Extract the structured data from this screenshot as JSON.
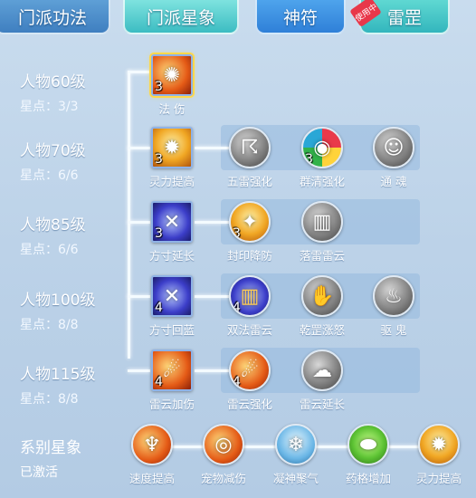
{
  "tabs": [
    {
      "label": "门派功法"
    },
    {
      "label": "门派星象"
    },
    {
      "label": "神符"
    },
    {
      "label": "雷罡"
    }
  ],
  "badge_text": "使用中",
  "rows": [
    {
      "level": "人物60级",
      "points": "星点：3/3"
    },
    {
      "level": "人物70级",
      "points": "星点：6/6"
    },
    {
      "level": "人物85级",
      "points": "星点：6/6"
    },
    {
      "level": "人物100级",
      "points": "星点：8/8"
    },
    {
      "level": "人物115级",
      "points": "星点：8/8"
    }
  ],
  "skills": {
    "r1": [
      {
        "name": "法 伤",
        "level": "3",
        "icon": "body-aura-icon"
      }
    ],
    "r2": [
      {
        "name": "灵力提高",
        "level": "3",
        "icon": "burst-icon"
      },
      {
        "name": "五雷强化",
        "level": "",
        "icon": "thunder-icon"
      },
      {
        "name": "群清强化",
        "level": "3",
        "icon": "rainbow-icon"
      },
      {
        "name": "通 魂",
        "level": "",
        "icon": "statue-icon"
      }
    ],
    "r3": [
      {
        "name": "方寸延长",
        "level": "3",
        "icon": "lightning-cross-icon"
      },
      {
        "name": "封印降防",
        "level": "3",
        "icon": "seal-break-icon"
      },
      {
        "name": "落雷雷云",
        "level": "",
        "icon": "talisman-icon"
      }
    ],
    "r4": [
      {
        "name": "方寸回蓝",
        "level": "4",
        "icon": "lightning-cross-icon"
      },
      {
        "name": "双法雷云",
        "level": "4",
        "icon": "talisman-icon"
      },
      {
        "name": "乾罡涨怒",
        "level": "",
        "icon": "gesture-icon"
      },
      {
        "name": "驱 鬼",
        "level": "",
        "icon": "ghost-icon"
      }
    ],
    "r5": [
      {
        "name": "雷云加伤",
        "level": "4",
        "icon": "flame-hand-icon"
      },
      {
        "name": "雷云强化",
        "level": "4",
        "icon": "flame-hand-icon"
      },
      {
        "name": "雷云延长",
        "level": "",
        "icon": "cloud-icon"
      }
    ]
  },
  "series": {
    "title": "系别星象",
    "status": "已激活",
    "items": [
      {
        "name": "速度提高",
        "icon": "fire-claw-icon"
      },
      {
        "name": "宠物减伤",
        "icon": "fire-shield-icon"
      },
      {
        "name": "凝神聚气",
        "icon": "meditation-icon"
      },
      {
        "name": "药格增加",
        "icon": "gem-icon"
      },
      {
        "name": "灵力提高",
        "icon": "burst-icon"
      }
    ]
  },
  "colors": {
    "accent": "#3cbcc2",
    "badge": "#e8384a"
  }
}
